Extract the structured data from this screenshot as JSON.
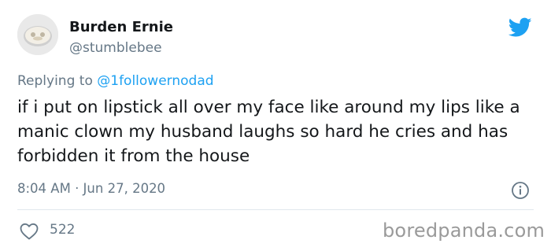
{
  "author": {
    "display_name": "Burden Ernie",
    "handle": "@stumblebee"
  },
  "reply": {
    "prefix": "Replying to",
    "mention": "@1followernodad"
  },
  "tweet": {
    "text": "if i put on lipstick all over my face like around my lips like a manic clown my husband laughs so hard he cries and has forbidden it from the house",
    "timestamp": "8:04 AM · Jun 27, 2020"
  },
  "engagement": {
    "likes": "522"
  },
  "watermark": "boredpanda.com",
  "colors": {
    "twitter_blue": "#1da1f2",
    "secondary_text": "#657786",
    "primary_text": "#14171a"
  },
  "icons": [
    "twitter-bird-icon",
    "info-icon",
    "heart-icon"
  ]
}
